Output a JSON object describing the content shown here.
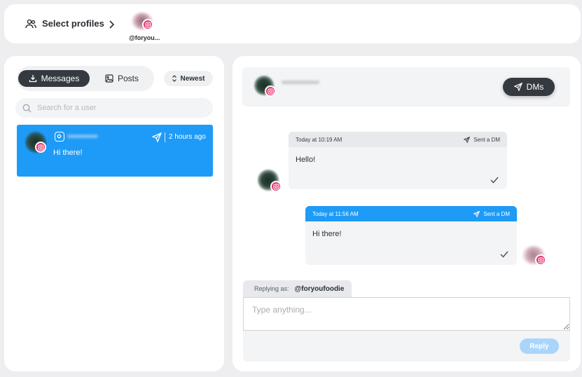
{
  "topbar": {
    "select_profiles_label": "Select profiles",
    "profile_handle": "@foryou..."
  },
  "left": {
    "tabs": [
      {
        "label": "Messages",
        "active": true
      },
      {
        "label": "Posts",
        "active": false
      }
    ],
    "sort_label": "Newest",
    "search_placeholder": "Search for a user",
    "conversations": [
      {
        "preview": "Hi there!",
        "time": "2 hours ago",
        "selected": true
      }
    ]
  },
  "chat": {
    "dms_label": "DMs",
    "messages": [
      {
        "timestamp": "Today at 10:19 AM",
        "status": "Sent a DM",
        "text": "Hello!",
        "direction": "incoming"
      },
      {
        "timestamp": "Today at 11:56 AM",
        "status": "Sent a DM",
        "text": "Hi there!",
        "direction": "outgoing"
      }
    ],
    "replying_as_label": "Replying as:",
    "replying_as_handle": "@foryoufoodie",
    "reply_placeholder": "Type anything...",
    "reply_button": "Reply"
  },
  "colors": {
    "accent_blue": "#1e9bf7",
    "instagram_pink": "#e1306c",
    "dark_button": "#343a40"
  },
  "icons": [
    "users-icon",
    "chevron-right-icon",
    "instagram-icon",
    "download-icon",
    "image-icon",
    "sort-icon",
    "search-icon",
    "send-icon",
    "check-icon"
  ]
}
